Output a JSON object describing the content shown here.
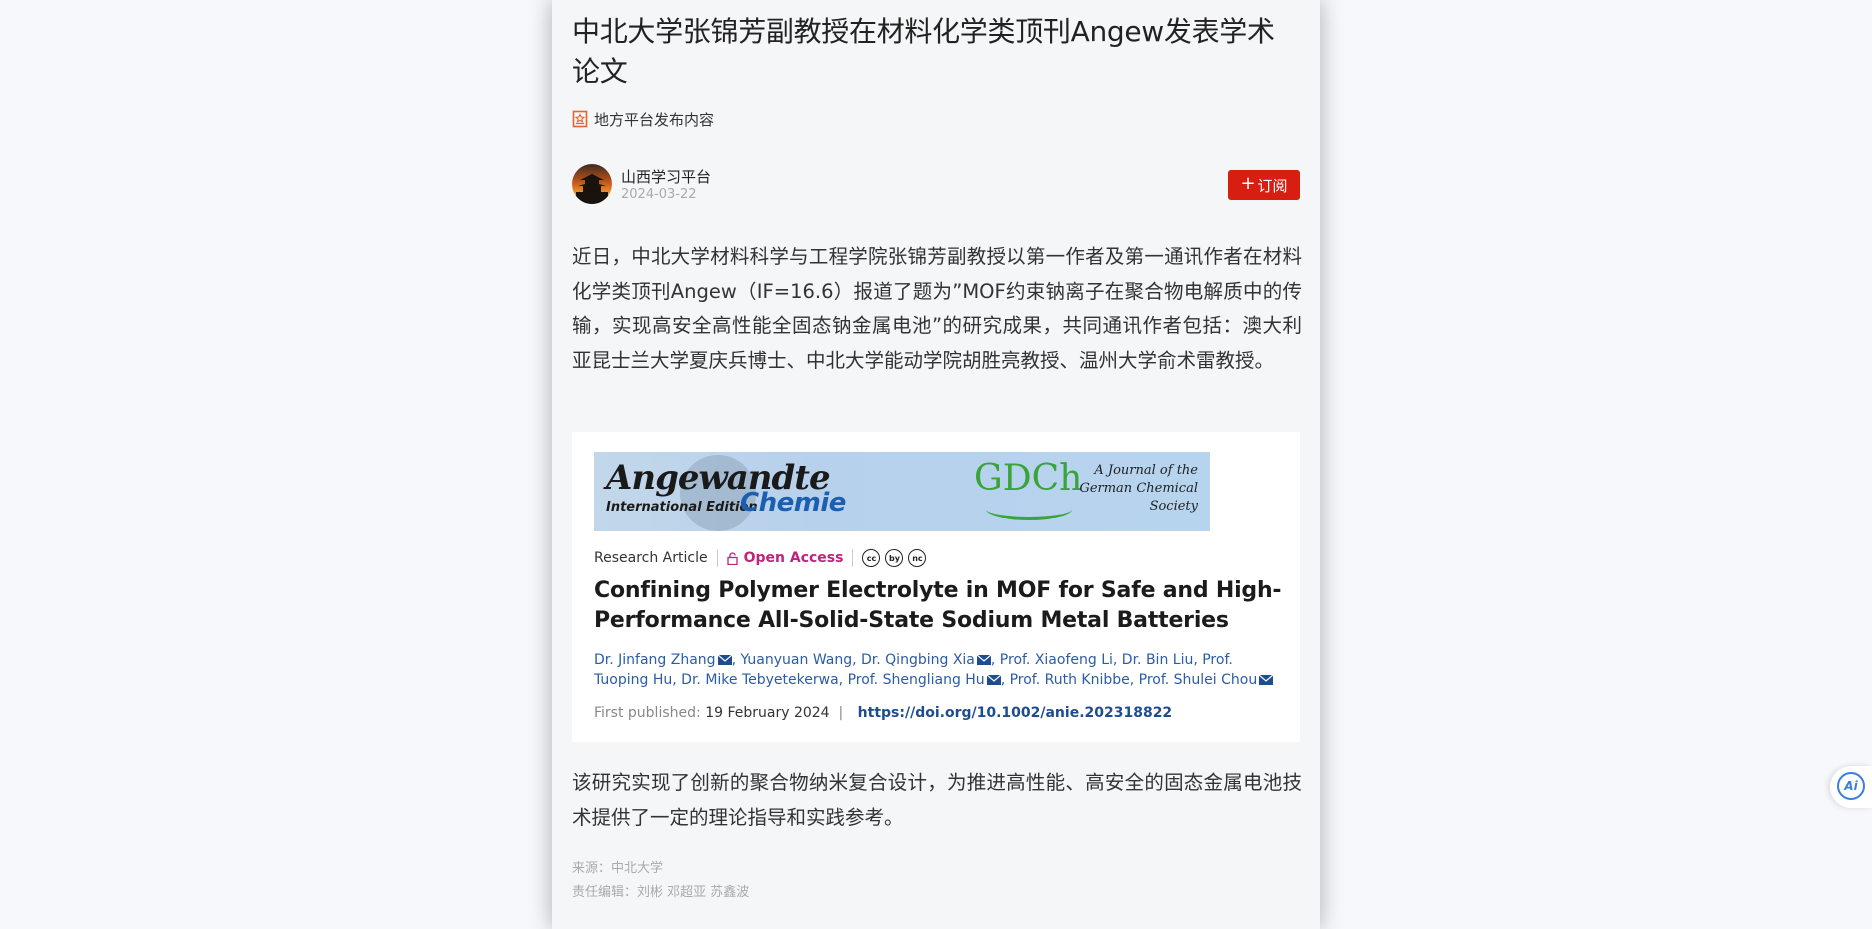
{
  "article": {
    "title": "中北大学张锦芳副教授在材料化学类顶刊Angew发表学术论文",
    "platform_tag": "地方平台发布内容",
    "author": "山西学习平台",
    "date": "2024-03-22",
    "subscribe_label": "订阅",
    "paragraph1": "近日，中北大学材料科学与工程学院张锦芳副教授以第一作者及第一通讯作者在材料化学类顶刊Angew（IF=16.6）报道了题为”MOF约束钠离子在聚合物电解质中的传输，实现高安全高性能全固态钠金属电池”的研究成果，共同通讯作者包括：澳大利亚昆士兰大学夏庆兵博士、中北大学能动学院胡胜亮教授、温州大学俞术雷教授。",
    "paragraph2": "该研究实现了创新的聚合物纳米复合设计，为推进高性能、高安全的固态金属电池技术提供了一定的理论指导和实践参考。",
    "source_label": "来源：中北大学",
    "editor_label": "责任编辑：刘彬 邓超亚 苏鑫波"
  },
  "figure": {
    "journal_name_1": "Angewandte",
    "journal_edition": "International Edition",
    "journal_name_2": "Chemie",
    "society_logo": "GDCh",
    "society_text": "A Journal of the German Chemical Society",
    "article_type": "Research Article",
    "open_access": "Open Access",
    "license_icons": [
      "cc",
      "by",
      "nc"
    ],
    "paper_title": "Confining Polymer Electrolyte in MOF for Safe and High-Performance All-Solid-State Sodium Metal Batteries",
    "authors": [
      {
        "name": "Dr. Jinfang Zhang",
        "mail": true
      },
      {
        "name": "Yuanyuan Wang",
        "mail": false
      },
      {
        "name": "Dr. Qingbing Xia",
        "mail": true
      },
      {
        "name": "Prof. Xiaofeng Li",
        "mail": false
      },
      {
        "name": "Dr. Bin Liu",
        "mail": false
      },
      {
        "name": "Prof. Tuoping Hu",
        "mail": false
      },
      {
        "name": "Dr. Mike Tebyetekerwa",
        "mail": false
      },
      {
        "name": "Prof. Shengliang Hu",
        "mail": true
      },
      {
        "name": "Prof. Ruth Knibbe",
        "mail": false
      },
      {
        "name": "Prof. Shulei Chou",
        "mail": true
      }
    ],
    "first_published_label": "First published:",
    "first_published_date": "19 February 2024",
    "doi": "https://doi.org/10.1002/anie.202318822"
  },
  "ai_button": "Ai",
  "colors": {
    "subscribe_bg": "#d81e10",
    "open_access": "#c0237c",
    "author_link": "#2a5ca8",
    "ai_accent": "#3a7ce0"
  }
}
